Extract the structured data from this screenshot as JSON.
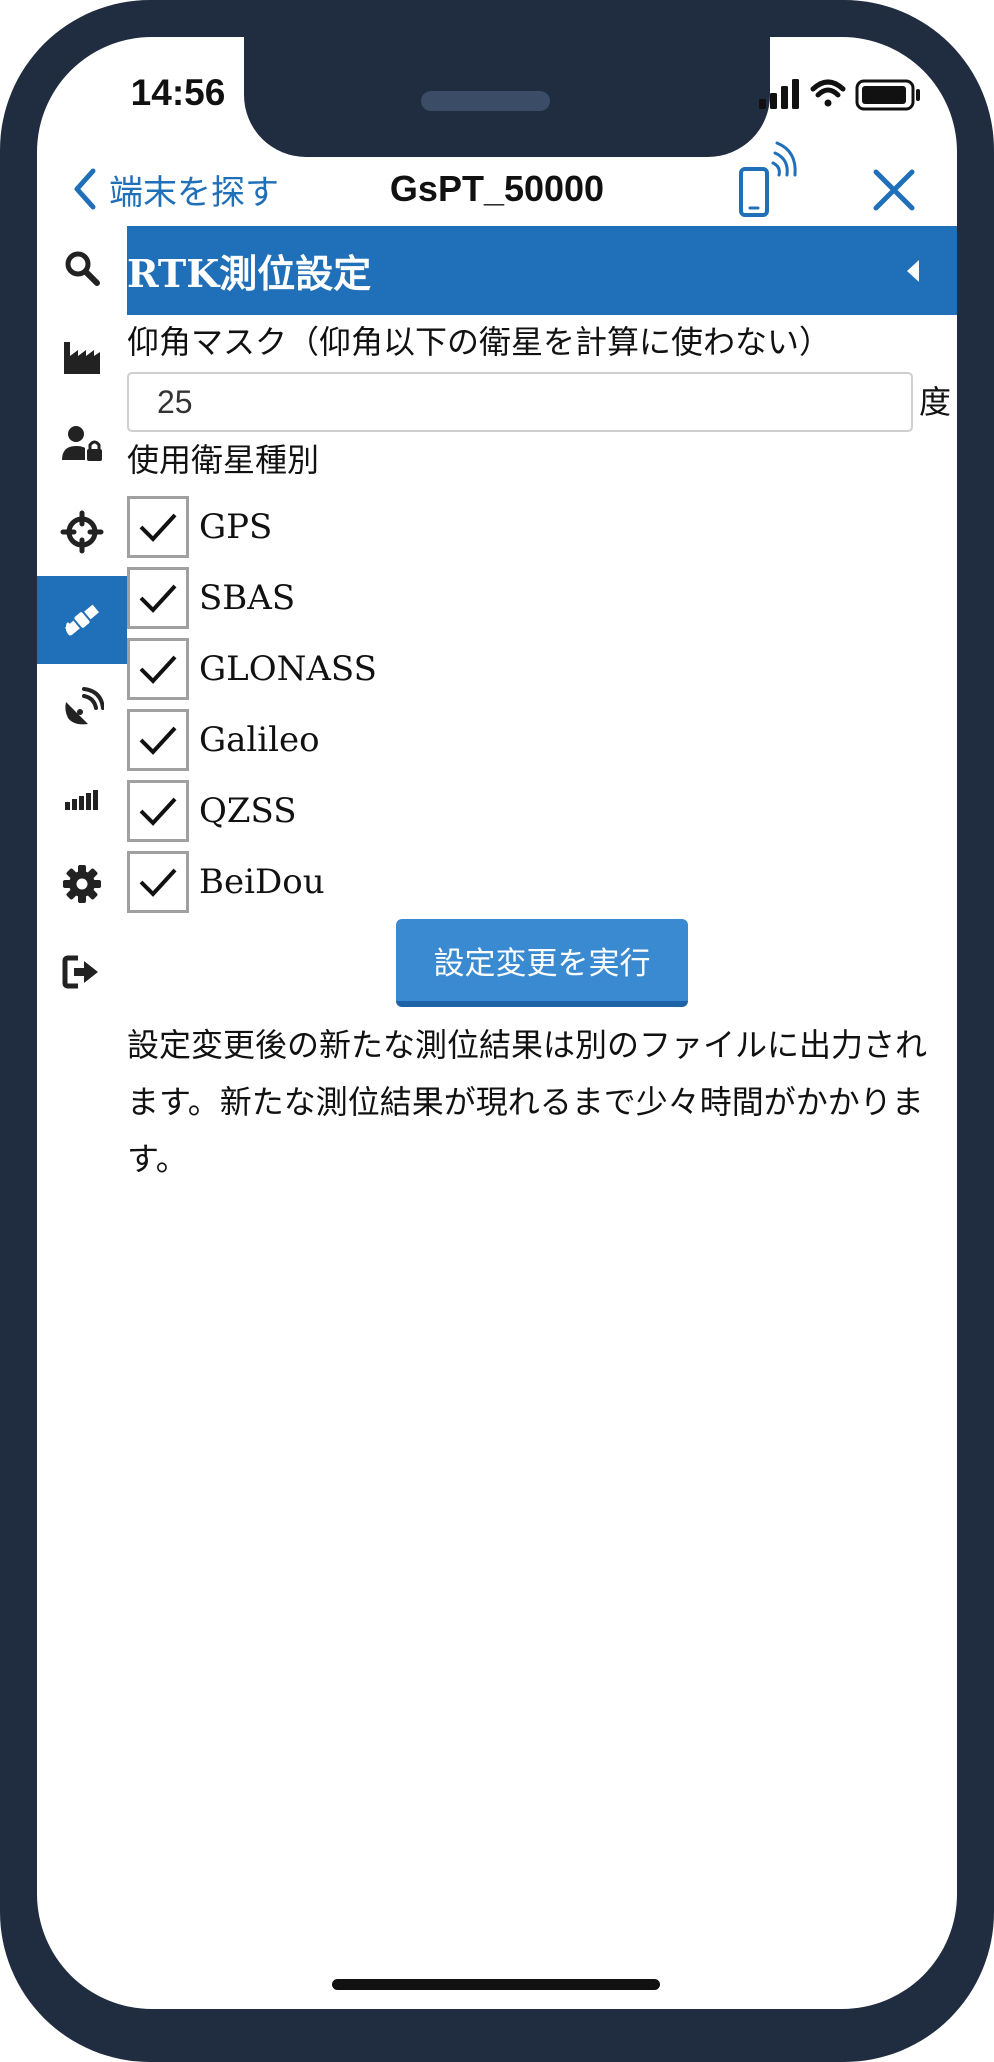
{
  "status_bar": {
    "time": "14:56"
  },
  "header": {
    "back_label": "端末を探す",
    "title": "GsPT_50000"
  },
  "sidebar": {
    "items": [
      {
        "name": "search-icon",
        "active": false
      },
      {
        "name": "factory-icon",
        "active": false
      },
      {
        "name": "user-lock-icon",
        "active": false
      },
      {
        "name": "crosshair-icon",
        "active": false
      },
      {
        "name": "satellite-icon",
        "active": true
      },
      {
        "name": "satellite-dish-icon",
        "active": false
      },
      {
        "name": "signal-bars-icon",
        "active": false
      },
      {
        "name": "gear-icon",
        "active": false
      },
      {
        "name": "sign-out-icon",
        "active": false
      }
    ]
  },
  "section": {
    "title": "RTK測位設定"
  },
  "elevation_mask": {
    "label": "仰角マスク（仰角以下の衛星を計算に使わない）",
    "value": "25",
    "unit": "度"
  },
  "satellites": {
    "label": "使用衛星種別",
    "items": [
      {
        "label": "GPS",
        "checked": true
      },
      {
        "label": "SBAS",
        "checked": true
      },
      {
        "label": "GLONASS",
        "checked": true
      },
      {
        "label": "Galileo",
        "checked": true
      },
      {
        "label": "QZSS",
        "checked": true
      },
      {
        "label": "BeiDou",
        "checked": true
      }
    ]
  },
  "apply_button": {
    "label": "設定変更を実行"
  },
  "note": "設定変更後の新たな測位結果は別のファイルに出力されます。新たな測位結果が現れるまで少々時間がかかります。",
  "colors": {
    "accent": "#1f6fb9",
    "button": "#3a8ad1",
    "frame": "#202d40"
  }
}
